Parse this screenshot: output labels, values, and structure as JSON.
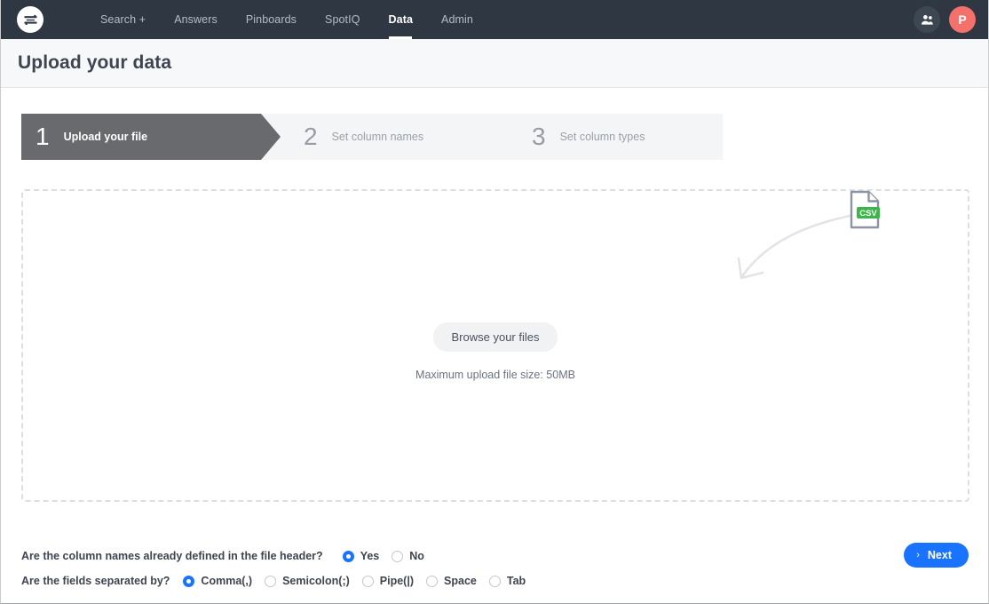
{
  "theme": {
    "nav_bg": "#2f3842",
    "accent_blue": "#1a73ff",
    "avatar_bg": "#f4706a",
    "active_step_bg": "#686a6e",
    "csv_badge_green": "#3cb54a"
  },
  "topnav": {
    "logo_name": "thoughtspot-logo",
    "links": [
      {
        "label": "Search +",
        "active": false
      },
      {
        "label": "Answers",
        "active": false
      },
      {
        "label": "Pinboards",
        "active": false
      },
      {
        "label": "SpotIQ",
        "active": false
      },
      {
        "label": "Data",
        "active": true
      },
      {
        "label": "Admin",
        "active": false
      }
    ],
    "people_icon": "people-icon",
    "avatar_initial": "P"
  },
  "header": {
    "title": "Upload your data"
  },
  "stepper": {
    "steps": [
      {
        "number": "1",
        "label": "Upload your file",
        "active": true
      },
      {
        "number": "2",
        "label": "Set column names",
        "active": false
      },
      {
        "number": "3",
        "label": "Set column types",
        "active": false
      }
    ]
  },
  "dropzone": {
    "browse_label": "Browse your files",
    "max_size_text": "Maximum upload file size: 50MB",
    "file_icon_label": "CSV",
    "file_icon_name": "csv-file-icon",
    "arrow_name": "curved-arrow-icon"
  },
  "options": {
    "header_question": "Are the column names already defined in the file header?",
    "header_options": [
      {
        "label": "Yes",
        "checked": true
      },
      {
        "label": "No",
        "checked": false
      }
    ],
    "separator_question": "Are the fields separated by?",
    "separator_options": [
      {
        "label": "Comma(,)",
        "checked": true
      },
      {
        "label": "Semicolon(;)",
        "checked": false
      },
      {
        "label": "Pipe(|)",
        "checked": false
      },
      {
        "label": "Space",
        "checked": false
      },
      {
        "label": "Tab",
        "checked": false
      }
    ]
  },
  "footer": {
    "next_label": "Next",
    "next_chevron": "›"
  }
}
